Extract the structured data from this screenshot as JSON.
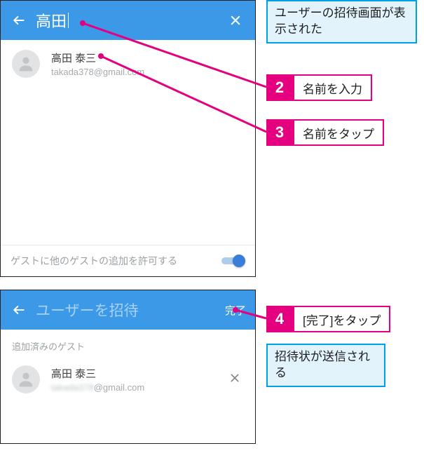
{
  "screen1": {
    "toolbar": {
      "search_value": "高田"
    },
    "result": {
      "name": "高田 泰三",
      "email": "takada378@gmail.com"
    },
    "footer": {
      "allow_label": "ゲストに他のゲストの追加を許可する",
      "toggle_on": true
    }
  },
  "screen2": {
    "toolbar": {
      "placeholder": "ユーザーを招待",
      "done_label": "完了"
    },
    "section_label": "追加済みのゲスト",
    "guest": {
      "name": "高田 泰三",
      "email_blurred": "takada378",
      "email_domain": "@gmail.com"
    }
  },
  "annotations": {
    "callout_top": "ユーザーの招待画面が表示された",
    "callout_sent": "招待状が送信される",
    "step2": {
      "num": "2",
      "label": "名前を入力"
    },
    "step3": {
      "num": "3",
      "label": "名前をタップ"
    },
    "step4": {
      "num": "4",
      "label": "[完了]をタップ"
    }
  },
  "icons": {
    "back": "back-arrow-icon",
    "clear": "close-icon",
    "avatar": "person-icon",
    "remove": "close-icon"
  }
}
